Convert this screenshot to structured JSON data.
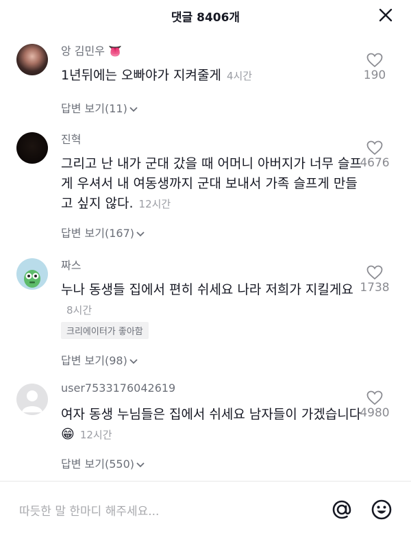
{
  "header": {
    "title": "댓글 8406개"
  },
  "comments": [
    {
      "name": "앙 김민우",
      "name_emoji": "👅",
      "text": "1년뒤에는 오빠야가 지켜줄게",
      "time": "4시간",
      "likes": "190",
      "replies": "답변 보기(11)"
    },
    {
      "name": "진혁",
      "text": "그리고 난 내가 군대 갔을 때 어머니 아버지가 너무 슬프게 우셔서 내 여동생까지 군대 보내서 가족 슬프게 만들고 싶지 않다.",
      "time": "12시간",
      "likes": "4676",
      "replies": "답변 보기(167)"
    },
    {
      "name": "짜스",
      "text": "누나 동생들 집에서 편히 쉬세요 나라 저희가 지킬게요",
      "time": "8시간",
      "likes": "1738",
      "badge": "크리에이터가 좋아함",
      "replies": "답변 보기(98)"
    },
    {
      "name": "user7533176042619",
      "text": "여자 동생 누님들은 집에서 쉬세요 남자들이 가겠습니다",
      "emoji": "😁",
      "time": "12시간",
      "likes": "4980",
      "replies": "답변 보기(550)"
    }
  ],
  "footer": {
    "placeholder": "따듯한 말 한마디 해주세요..."
  }
}
